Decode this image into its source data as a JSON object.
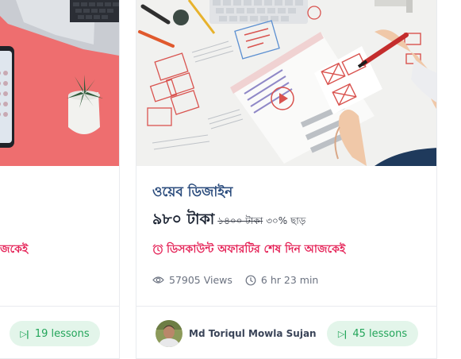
{
  "left_card": {
    "discount_text": "জকেই",
    "lessons_label": "19 lessons",
    "icons": {
      "lessons": "play-step-icon"
    }
  },
  "right_card": {
    "title": "ওয়েব ডিজাইন",
    "price": "৯৮০ টাকা",
    "old_price": "১৪০০ টাকা",
    "discount_percent": "৩০% ছাড়",
    "offer_text": "ডিসকাউন্ট অফারটির শেষ দিন আজকেই",
    "views": "57905 Views",
    "duration": "6 hr 23 min",
    "author_name": "Md Toriqul Mowla Sujan",
    "lessons_label": "45 lessons",
    "icons": {
      "offer": "alarm-clock-icon",
      "views": "eye-icon",
      "duration": "clock-icon",
      "lessons": "play-step-icon"
    }
  },
  "colors": {
    "title": "#2a4b7c",
    "offer": "#e5265a",
    "pill_bg": "#e3f5ea",
    "pill_text": "#23a55a",
    "left_thumb_bg": "#ee6d6d"
  }
}
